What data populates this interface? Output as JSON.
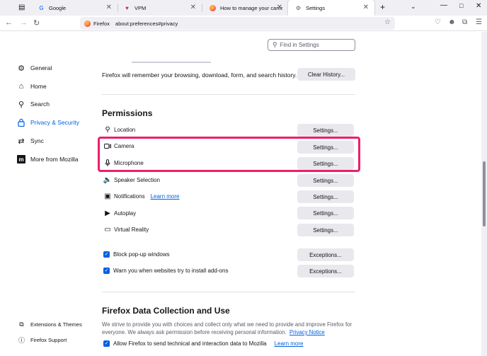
{
  "tabs": [
    {
      "title": "Google",
      "icon": "google-icon"
    },
    {
      "title": "VPM",
      "icon": "vpm-icon"
    },
    {
      "title": "How to manage your camera a",
      "icon": "firefox-icon"
    },
    {
      "title": "Settings",
      "icon": "gear-icon",
      "active": true
    }
  ],
  "navbar": {
    "identity_label": "Firefox",
    "url": "about:preferences#privacy"
  },
  "sidebar": {
    "items": [
      {
        "label": "General",
        "icon": "gear-icon"
      },
      {
        "label": "Home",
        "icon": "home-icon"
      },
      {
        "label": "Search",
        "icon": "search-icon"
      },
      {
        "label": "Privacy & Security",
        "icon": "lock-icon",
        "active": true
      },
      {
        "label": "Sync",
        "icon": "sync-icon"
      },
      {
        "label": "More from Mozilla",
        "icon": "mozilla-icon"
      }
    ],
    "footer": [
      {
        "label": "Extensions & Themes",
        "icon": "puzzle-icon"
      },
      {
        "label": "Firefox Support",
        "icon": "help-icon"
      }
    ]
  },
  "search": {
    "placeholder": "Find in Settings"
  },
  "history": {
    "text": "Firefox will remember your browsing, download, form, and search history.",
    "button": "Clear History..."
  },
  "permissions": {
    "heading": "Permissions",
    "rows": [
      {
        "label": "Location",
        "icon": "location-icon",
        "button": "Settings..."
      },
      {
        "label": "Camera",
        "icon": "camera-icon",
        "button": "Settings..."
      },
      {
        "label": "Microphone",
        "icon": "microphone-icon",
        "button": "Settings..."
      },
      {
        "label": "Speaker Selection",
        "icon": "speaker-icon",
        "button": "Settings..."
      },
      {
        "label": "Notifications",
        "icon": "notification-icon",
        "button": "Settings...",
        "link": "Learn more"
      },
      {
        "label": "Autoplay",
        "icon": "autoplay-icon",
        "button": "Settings..."
      },
      {
        "label": "Virtual Reality",
        "icon": "vr-icon",
        "button": "Settings..."
      }
    ],
    "checks": [
      {
        "label": "Block pop-up windows",
        "checked": true,
        "button": "Exceptions..."
      },
      {
        "label": "Warn you when websites try to install add-ons",
        "checked": true,
        "button": "Exceptions..."
      }
    ]
  },
  "data_collection": {
    "heading": "Firefox Data Collection and Use",
    "description": "We strive to provide you with choices and collect only what we need to provide and improve Firefox for everyone. We always ask permission before receiving personal information.",
    "privacy_link": "Privacy Notice",
    "check_label": "Allow Firefox to send technical and interaction data to Mozilla",
    "check_link": "Learn more"
  },
  "colors": {
    "accent": "#0061e0",
    "highlight": "#ed1f6b"
  }
}
